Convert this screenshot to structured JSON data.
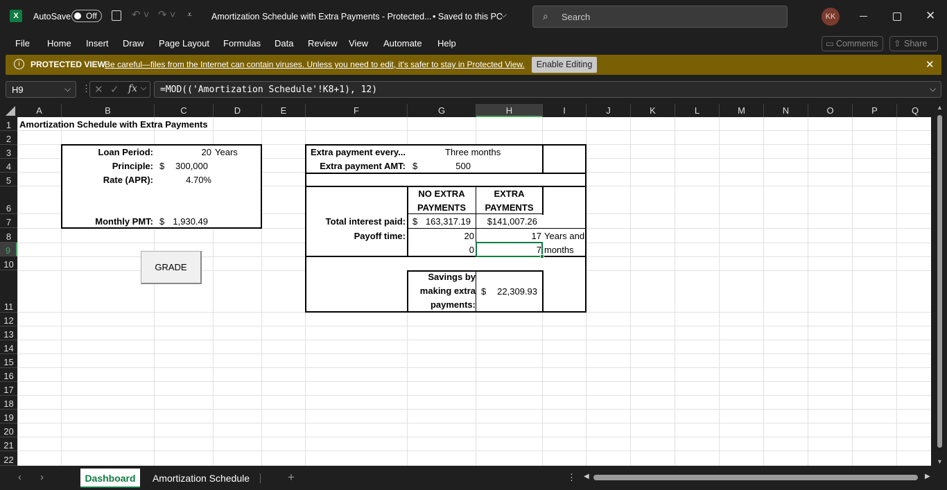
{
  "titlebar": {
    "autosave_label": "AutoSave",
    "autosave_state": "Off",
    "doc_title": "Amortization Schedule with Extra Payments  -  Protected...",
    "save_status": "• Saved to this PC",
    "search_placeholder": "Search",
    "user_initials": "KK"
  },
  "menu": [
    "File",
    "Home",
    "Insert",
    "Draw",
    "Page Layout",
    "Formulas",
    "Data",
    "Review",
    "View",
    "Automate",
    "Help"
  ],
  "header_buttons": {
    "comments": "Comments",
    "share": "Share"
  },
  "protected_view": {
    "label": "PROTECTED VIEW",
    "message": "Be careful—files from the Internet can contain viruses. Unless you need to edit, it's safer to stay in Protected View.",
    "enable_button": "Enable Editing"
  },
  "formula_bar": {
    "name_box": "H9",
    "fx": "fx",
    "formula": "=MOD(('Amortization Schedule'!K8+1), 12)"
  },
  "columns": [
    "A",
    "B",
    "C",
    "D",
    "E",
    "F",
    "G",
    "H",
    "I",
    "J",
    "K",
    "L",
    "M",
    "N",
    "O",
    "P",
    "Q"
  ],
  "rows": [
    "1",
    "2",
    "3",
    "4",
    "5",
    "6",
    "7",
    "8",
    "9",
    "10",
    "11",
    "12",
    "13",
    "14",
    "15",
    "16",
    "17",
    "18",
    "19",
    "20",
    "21",
    "22"
  ],
  "sheet": {
    "title": "Amortization Schedule with Extra Payments",
    "loan_period_label": "Loan Period:",
    "loan_period_value": "20",
    "loan_period_unit": "Years",
    "principle_label": "Principle:",
    "principle_currency": "$",
    "principle_value": "300,000",
    "rate_label": "Rate (APR):",
    "rate_value": "4.70%",
    "monthly_pmt_label": "Monthly PMT:",
    "monthly_pmt_currency": "$",
    "monthly_pmt_value": "1,930.49",
    "grade_button": "GRADE",
    "extra_every_label": "Extra payment every...",
    "extra_every_value": "Three months",
    "extra_amt_label": "Extra payment AMT:",
    "extra_amt_currency": "$",
    "extra_amt_value": "500",
    "no_extra_header_1": "NO EXTRA",
    "no_extra_header_2": "PAYMENTS",
    "extra_header_1": "EXTRA",
    "extra_header_2": "PAYMENTS",
    "total_interest_label": "Total interest paid:",
    "total_interest_no_extra_currency": "$",
    "total_interest_no_extra": "163,317.19",
    "total_interest_extra": "$141,007.26",
    "payoff_label": "Payoff time:",
    "payoff_years_no_extra": "20",
    "payoff_years_extra": "17",
    "payoff_years_unit": "Years and",
    "payoff_months_no_extra": "0",
    "payoff_months_extra": "7",
    "payoff_months_unit": "months",
    "savings_label_1": "Savings by",
    "savings_label_2": "making extra",
    "savings_label_3": "payments:",
    "savings_currency": "$",
    "savings_value": "22,309.93"
  },
  "sheet_tabs": [
    "Dashboard",
    "Amortization Schedule"
  ],
  "active_tab": "Dashboard"
}
